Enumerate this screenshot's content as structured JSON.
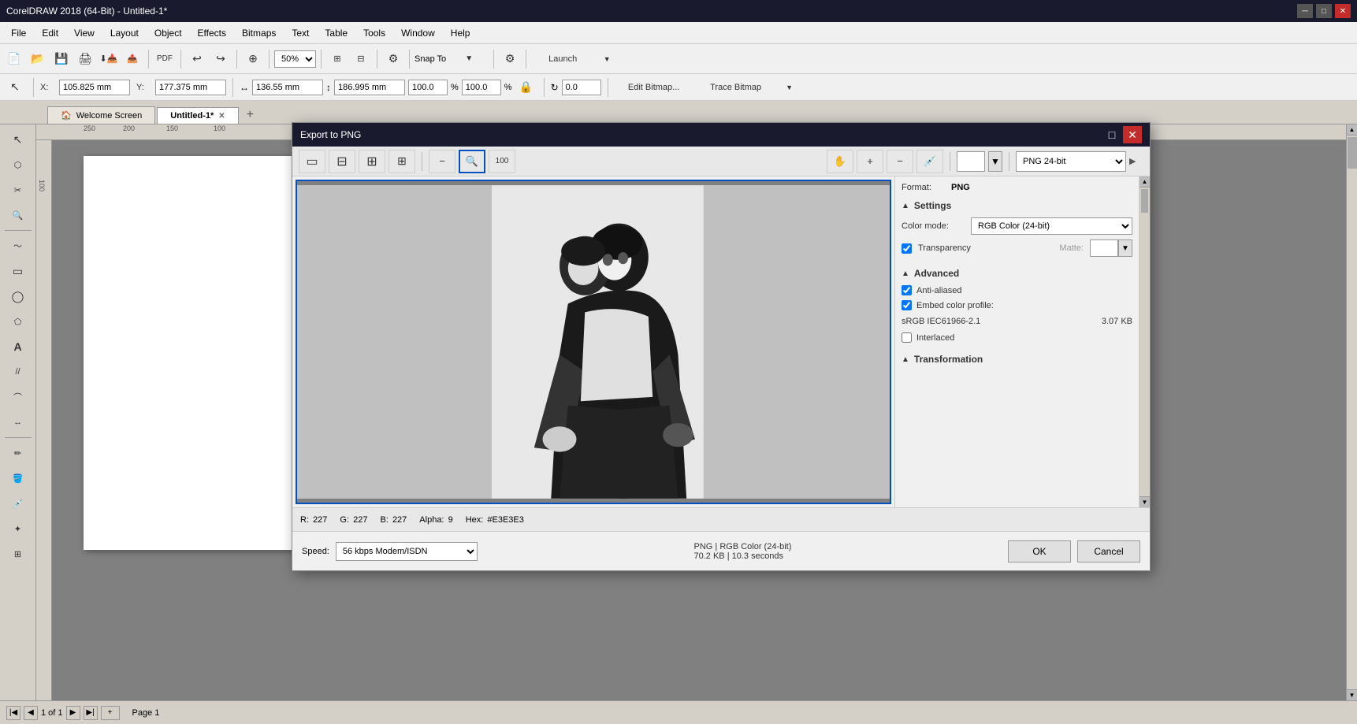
{
  "titlebar": {
    "title": "CorelDRAW 2018 (64-Bit) - Untitled-1*"
  },
  "menubar": {
    "items": [
      "File",
      "Edit",
      "View",
      "Layout",
      "Object",
      "Effects",
      "Bitmaps",
      "Text",
      "Table",
      "Tools",
      "Window",
      "Help"
    ]
  },
  "toolbar": {
    "zoom_value": "50%",
    "snap_label": "Snap To",
    "launch_label": "Launch"
  },
  "toolbar2": {
    "x_label": "X:",
    "x_value": "105.825 mm",
    "y_label": "Y:",
    "y_value": "177.375 mm",
    "w_value": "136.55 mm",
    "h_value": "186.995 mm",
    "scale_x": "100.0",
    "scale_y": "100.0",
    "pct": "%",
    "angle": "0.0",
    "bitmap_btn": "Edit Bitmap...",
    "trace_btn": "Trace Bitmap"
  },
  "tabs": {
    "welcome": "Welcome Screen",
    "untitled": "Untitled-1*",
    "add": "+"
  },
  "dialog": {
    "title": "Export to PNG",
    "format_label": "Format:",
    "format_value": "PNG",
    "format_select": "PNG 24-bit",
    "sections": {
      "settings": {
        "label": "Settings",
        "color_mode_label": "Color mode:",
        "color_mode_value": "RGB Color (24-bit)",
        "transparency_label": "Transparency",
        "transparency_checked": true,
        "matte_label": "Matte:"
      },
      "advanced": {
        "label": "Advanced",
        "anti_aliased_label": "Anti-aliased",
        "anti_aliased_checked": true,
        "embed_color_label": "Embed color profile:",
        "embed_color_checked": true,
        "embed_color_value": "sRGB IEC61966-2.1",
        "file_size": "3.07 KB",
        "interlaced_label": "Interlaced",
        "interlaced_checked": false
      },
      "transformation": {
        "label": "Transformation"
      }
    },
    "status": {
      "file_type": "PNG",
      "color_mode": "RGB Color (24-bit)",
      "file_size": "70.2 KB",
      "time": "10.3 seconds"
    },
    "pixel_info": {
      "r_label": "R:",
      "r_value": "227",
      "g_label": "G:",
      "g_value": "227",
      "b_label": "B:",
      "b_value": "227",
      "alpha_label": "Alpha:",
      "alpha_value": "9",
      "hex_label": "Hex:",
      "hex_value": "#E3E3E3"
    },
    "footer": {
      "speed_label": "Speed:",
      "speed_value": "56 kbps Modem/ISDN",
      "ok": "OK",
      "cancel": "Cancel"
    }
  },
  "statusbar": {
    "page_of": "1 of 1",
    "page_label": "Page 1"
  },
  "icons": {
    "new": "📄",
    "open": "📂",
    "save": "💾",
    "print": "🖨",
    "undo": "↩",
    "redo": "↪",
    "zoom_in": "🔍",
    "zoom_out": "🔎",
    "select": "↖",
    "hand": "✋",
    "rectangle": "▭",
    "ellipse": "◯",
    "text": "A",
    "pencil": "✏",
    "eyedropper": "💉"
  }
}
